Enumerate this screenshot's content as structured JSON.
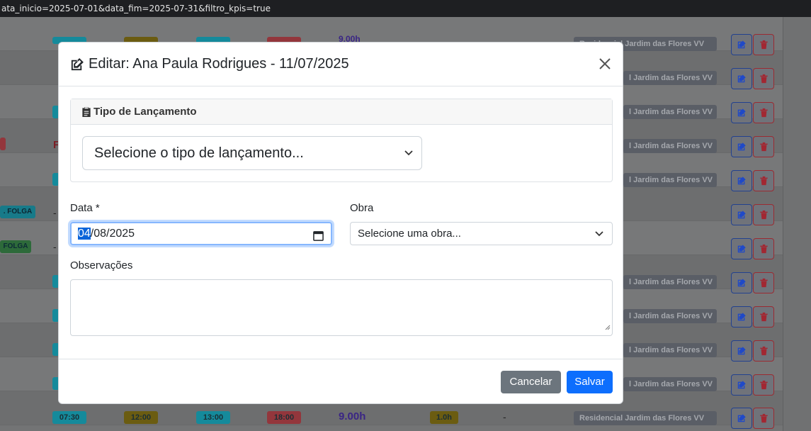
{
  "browser": {
    "url_fragment": "ata_inicio=2025-07-01&data_fim=2025-07-31&filtro_kpis=true"
  },
  "background": {
    "site_name": "Residencial Jardim das Flores VV",
    "site_name_partial": "l Jardim das Flores VV",
    "folga_badge_1": ". FOLGA",
    "folga_badge_2": "FOLGA",
    "dash": "-",
    "row_top_hours": "9.00h",
    "red_letter": "F",
    "bottom_row": {
      "entrada": "07:30",
      "saida_almoco": "12:00",
      "volta_almoco": "13:00",
      "saida": "18:00",
      "horas": "9.00h",
      "extra": "1.0h",
      "dash": "-",
      "obra": "Residencial Jardim das Flores VV"
    }
  },
  "modal": {
    "title": "Editar: Ana Paula Rodrigues - 11/07/2025",
    "tipo_section": {
      "header": "Tipo de Lançamento",
      "select_value": "Selecione o tipo de lançamento..."
    },
    "data_field": {
      "label": "Data *",
      "value_day": "04",
      "value_rest": "/08/2025"
    },
    "obra_field": {
      "label": "Obra",
      "value": "Selecione uma obra..."
    },
    "observacoes_field": {
      "label": "Observações",
      "value": ""
    },
    "footer": {
      "cancel_label": "Cancelar",
      "save_label": "Salvar"
    }
  },
  "colors": {
    "primary": "#0d6efd",
    "secondary": "#6c757d",
    "focus_border": "#86b7fe"
  }
}
